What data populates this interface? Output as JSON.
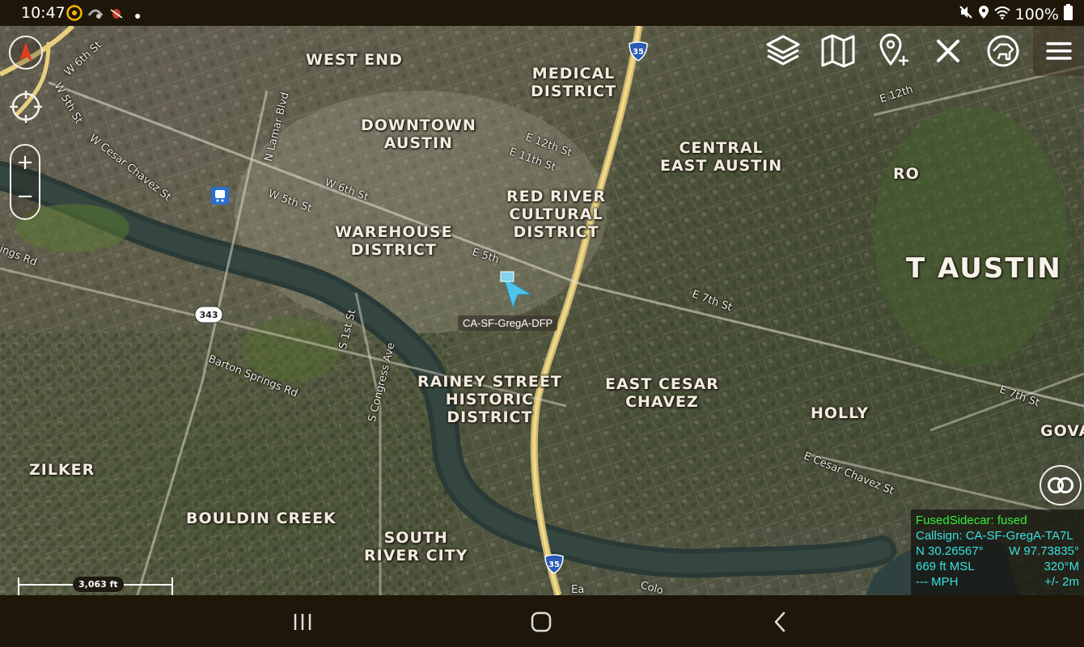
{
  "status_bar": {
    "time": "10:47",
    "battery": "100%",
    "icons_left": [
      "atak-app-icon",
      "signal-map-icon",
      "bug-icon",
      "dot-icon"
    ],
    "icons_right": [
      "mute-icon",
      "location-icon",
      "wifi-icon",
      "battery-icon"
    ]
  },
  "map": {
    "neighborhoods": [
      {
        "id": "west-end",
        "text": "WEST END"
      },
      {
        "id": "medical-district",
        "text": "MEDICAL\nDISTRICT"
      },
      {
        "id": "downtown-austin",
        "text": "DOWNTOWN\nAUSTIN"
      },
      {
        "id": "central-east-austin",
        "text": "CENTRAL\nEAST AUSTIN"
      },
      {
        "id": "red-river",
        "text": "RED RIVER\nCULTURAL\nDISTRICT"
      },
      {
        "id": "warehouse-district",
        "text": "WAREHOUSE\nDISTRICT"
      },
      {
        "id": "east-austin",
        "text": "T AUSTIN"
      },
      {
        "id": "ro",
        "text": "RO"
      },
      {
        "id": "rainey-street",
        "text": "RAINEY STREET\nHISTORIC\nDISTRICT"
      },
      {
        "id": "east-cesar-chavez",
        "text": "EAST CESAR\nCHAVEZ"
      },
      {
        "id": "holly",
        "text": "HOLLY"
      },
      {
        "id": "gova",
        "text": "GOVA"
      },
      {
        "id": "zilker",
        "text": "ZILKER"
      },
      {
        "id": "bouldin-creek",
        "text": "BOULDIN CREEK"
      },
      {
        "id": "south-river-city",
        "text": "SOUTH\nRIVER CITY"
      }
    ],
    "streets": [
      {
        "id": "w6th-a",
        "text": "W 6th St"
      },
      {
        "id": "w5th-a",
        "text": "W 5th St"
      },
      {
        "id": "cesar-chavez-w",
        "text": "W Cesar Chavez St"
      },
      {
        "id": "lamar",
        "text": "N Lamar Blvd"
      },
      {
        "id": "w5th-b",
        "text": "W 5th St"
      },
      {
        "id": "w6th-b",
        "text": "W 6th St"
      },
      {
        "id": "e12th",
        "text": "E 12th St"
      },
      {
        "id": "e11th",
        "text": "E 11th St"
      },
      {
        "id": "e12th-r",
        "text": "E 12th"
      },
      {
        "id": "e5th",
        "text": "E 5th"
      },
      {
        "id": "e7th",
        "text": "E 7th St"
      },
      {
        "id": "e7th-r",
        "text": "E 7th St"
      },
      {
        "id": "s1st",
        "text": "S 1st St"
      },
      {
        "id": "congress",
        "text": "S Congress Ave"
      },
      {
        "id": "barton-springs",
        "text": "Barton Springs Rd"
      },
      {
        "id": "cesar-chavez-e",
        "text": "E Cesar Chavez St"
      },
      {
        "id": "springs-rd",
        "text": "ings Rd"
      },
      {
        "id": "colorado",
        "text": "Colo"
      },
      {
        "id": "e-sym",
        "text": "Ea"
      }
    ],
    "shields": [
      {
        "id": "i35-top",
        "text": "35"
      },
      {
        "id": "i35-bottom",
        "text": "35"
      },
      {
        "id": "loop343",
        "text": "343"
      }
    ],
    "self_callsign_label": "CA-SF-GregA-DFP",
    "scale_label": "3,063 ft"
  },
  "controls": {
    "zoom_in": "+",
    "zoom_out": "−"
  },
  "toolbar": {
    "items": [
      "layers-icon",
      "map-icon",
      "add-point-icon",
      "close-icon",
      "map-dog-icon",
      "hamburger-menu-icon"
    ]
  },
  "infobox": {
    "status": "FusedSidecar: fused",
    "callsign": "Callsign: CA-SF-GregA-TA7L",
    "lat": "N 30.26567°",
    "lon": "W 97.73835°",
    "alt": "669 ft MSL",
    "heading": "320°M",
    "speed": "--- MPH",
    "accuracy": "+/- 2m"
  },
  "colors": {
    "self_marker": "#4fc3e8",
    "infobox_status": "#35f03a",
    "infobox_text": "#39e0e0",
    "compass_arrow": "#e23b1e"
  }
}
